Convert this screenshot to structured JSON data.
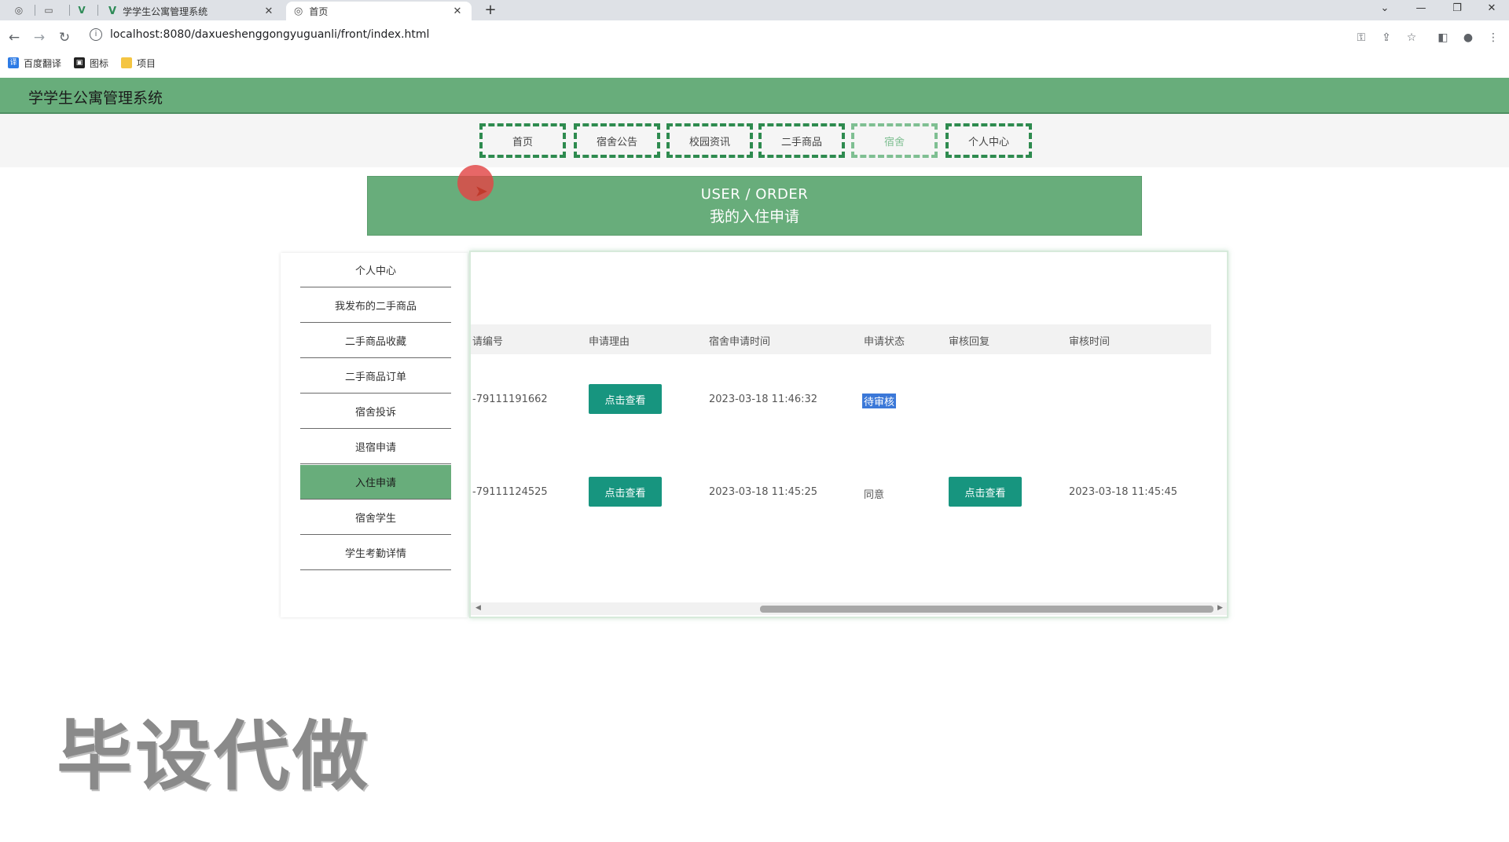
{
  "browser": {
    "tabs": [
      {
        "title": "学学生公寓管理系统",
        "icon": "vue-logo-icon"
      },
      {
        "title": "首页",
        "icon": "globe-icon"
      }
    ],
    "new_tab": "+",
    "url": "localhost:8080/daxueshenggongyuguanli/front/index.html",
    "bookmarks": [
      {
        "label": "百度翻译",
        "icon": "translate-icon"
      },
      {
        "label": "图标",
        "icon": "image-icon"
      },
      {
        "label": "项目",
        "icon": "folder-icon"
      }
    ]
  },
  "site": {
    "title": "学学生公寓管理系统"
  },
  "nav": {
    "items": [
      "首页",
      "宿舍公告",
      "校园资讯",
      "二手商品",
      "宿舍",
      "个人中心"
    ]
  },
  "banner": {
    "en": "USER / ORDER",
    "cn": "我的入住申请"
  },
  "side_menu": {
    "items": [
      "个人中心",
      "我发布的二手商品",
      "二手商品收藏",
      "二手商品订单",
      "宿舍投诉",
      "退宿申请",
      "入住申请",
      "宿舍学生",
      "学生考勤详情"
    ],
    "active": "入住申请"
  },
  "table": {
    "headers": [
      "请编号",
      "申请理由",
      "宿舍申请时间",
      "申请状态",
      "审核回复",
      "审核时间"
    ],
    "view_label": "点击查看",
    "rows": [
      {
        "id": "-79111191662",
        "apply_time": "2023-03-18 11:46:32",
        "status": "待审核",
        "review_time": ""
      },
      {
        "id": "-79111124525",
        "apply_time": "2023-03-18 11:45:25",
        "status": "同意",
        "review_time": "2023-03-18 11:45:45"
      }
    ]
  },
  "watermark": "毕设代做",
  "colors": {
    "theme_green": "#68ad7b",
    "button_teal": "#17957f",
    "nav_border": "#2e8b4f"
  }
}
